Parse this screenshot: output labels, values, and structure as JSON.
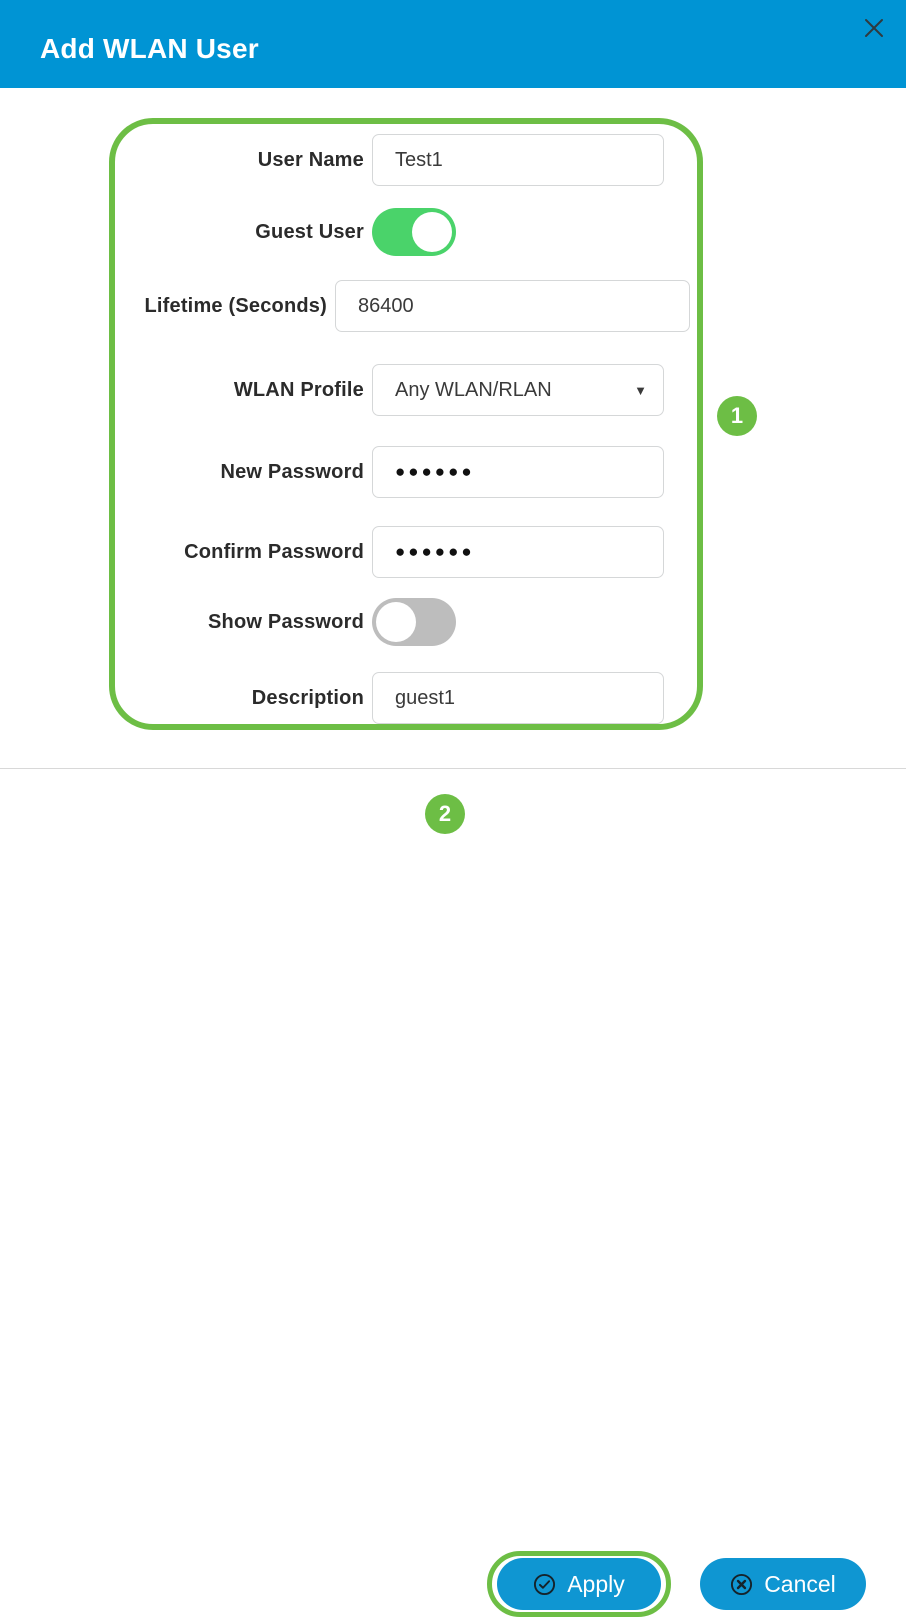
{
  "header": {
    "title": "Add WLAN User",
    "close_icon": "close-icon",
    "background_color": "#0094d4"
  },
  "colors": {
    "header_blue": "#0094d4",
    "button_blue": "#0f96d2",
    "annotation_green": "#6dbe45",
    "toggle_on_green": "#4ad36a",
    "toggle_off_gray": "#bdbdbd"
  },
  "form": {
    "fields": [
      {
        "label": "User Name",
        "value": "Test1",
        "type": "text"
      },
      {
        "label": "Guest User",
        "value": "on",
        "type": "toggle"
      },
      {
        "label": "Lifetime (Seconds)",
        "value": "86400",
        "type": "text"
      },
      {
        "label": "WLAN Profile",
        "value": "Any WLAN/RLAN",
        "type": "select",
        "caret": "▼"
      },
      {
        "label": "New Password",
        "value": "●●●●●●",
        "type": "password"
      },
      {
        "label": "Confirm Password",
        "value": "●●●●●●",
        "type": "password"
      },
      {
        "label": "Show Password",
        "value": "off",
        "type": "toggle"
      },
      {
        "label": "Description",
        "value": "guest1",
        "type": "text"
      }
    ]
  },
  "annotations": {
    "step_one": "1",
    "step_two": "2"
  },
  "footer": {
    "apply_label": "Apply",
    "apply_icon": "check-circle-icon",
    "cancel_label": "Cancel",
    "cancel_icon": "x-circle-icon"
  }
}
